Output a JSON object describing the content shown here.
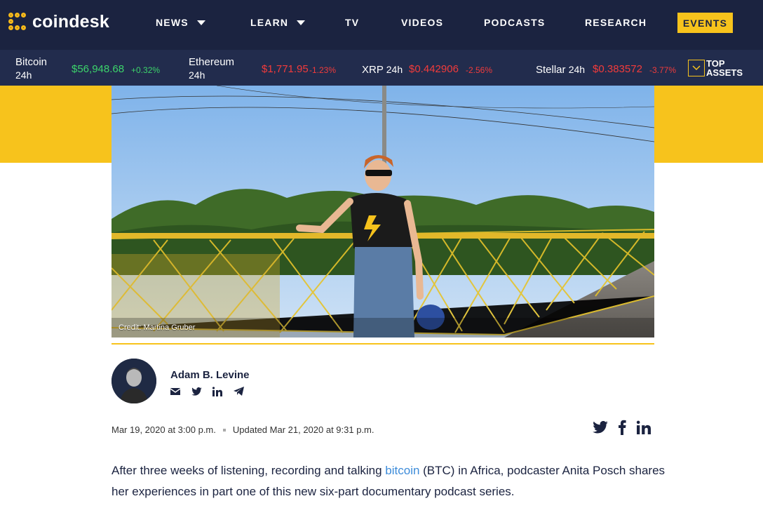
{
  "header": {
    "logo_text": "coindesk",
    "nav": [
      {
        "label": "NEWS",
        "has_caret": true
      },
      {
        "label": "LEARN",
        "has_caret": true
      },
      {
        "label": "TV",
        "has_caret": false
      },
      {
        "label": "VIDEOS",
        "has_caret": false
      },
      {
        "label": "PODCASTS",
        "has_caret": false
      },
      {
        "label": "RESEARCH",
        "has_caret": false
      }
    ],
    "events_label": "EVENTS"
  },
  "ticker": {
    "items": [
      {
        "name": "Bitcoin",
        "period": "24h",
        "price": "$56,948.68",
        "change": "+0.32%",
        "direction": "up"
      },
      {
        "name": "Ethereum",
        "period": "24h",
        "price": "$1,771.95",
        "change": "-1.23%",
        "direction": "down"
      },
      {
        "name": "XRP",
        "period": "24h",
        "price": "$0.442906",
        "change": "-2.56%",
        "direction": "down"
      },
      {
        "name": "Stellar",
        "period": "24h",
        "price": "$0.383572",
        "change": "-3.77%",
        "direction": "down"
      }
    ],
    "top_assets_line1": "TOP",
    "top_assets_line2": "ASSETS"
  },
  "hero": {
    "credit": "Credit: Martina Gruber"
  },
  "author": {
    "name": "Adam B. Levine",
    "icons": [
      "email-icon",
      "twitter-icon",
      "linkedin-icon",
      "telegram-icon"
    ]
  },
  "meta": {
    "published": "Mar 19, 2020 at 3:00 p.m.",
    "updated": "Updated Mar 21, 2020 at 9:31 p.m."
  },
  "share_icons": [
    "twitter-icon",
    "facebook-icon",
    "linkedin-icon"
  ],
  "article": {
    "intro_before_link": "After three weeks of listening, recording and talking ",
    "link_text": "bitcoin",
    "intro_after_link": " (BTC) in Africa, podcaster Anita Posch shares her experiences in part one of this new six-part documentary podcast series."
  },
  "colors": {
    "nav_bg": "#1b2340",
    "ticker_bg": "#222c4d",
    "brand_yellow": "#f7c31c",
    "up": "#3cd46b",
    "down": "#f23b3b",
    "link": "#3c8bd9"
  }
}
